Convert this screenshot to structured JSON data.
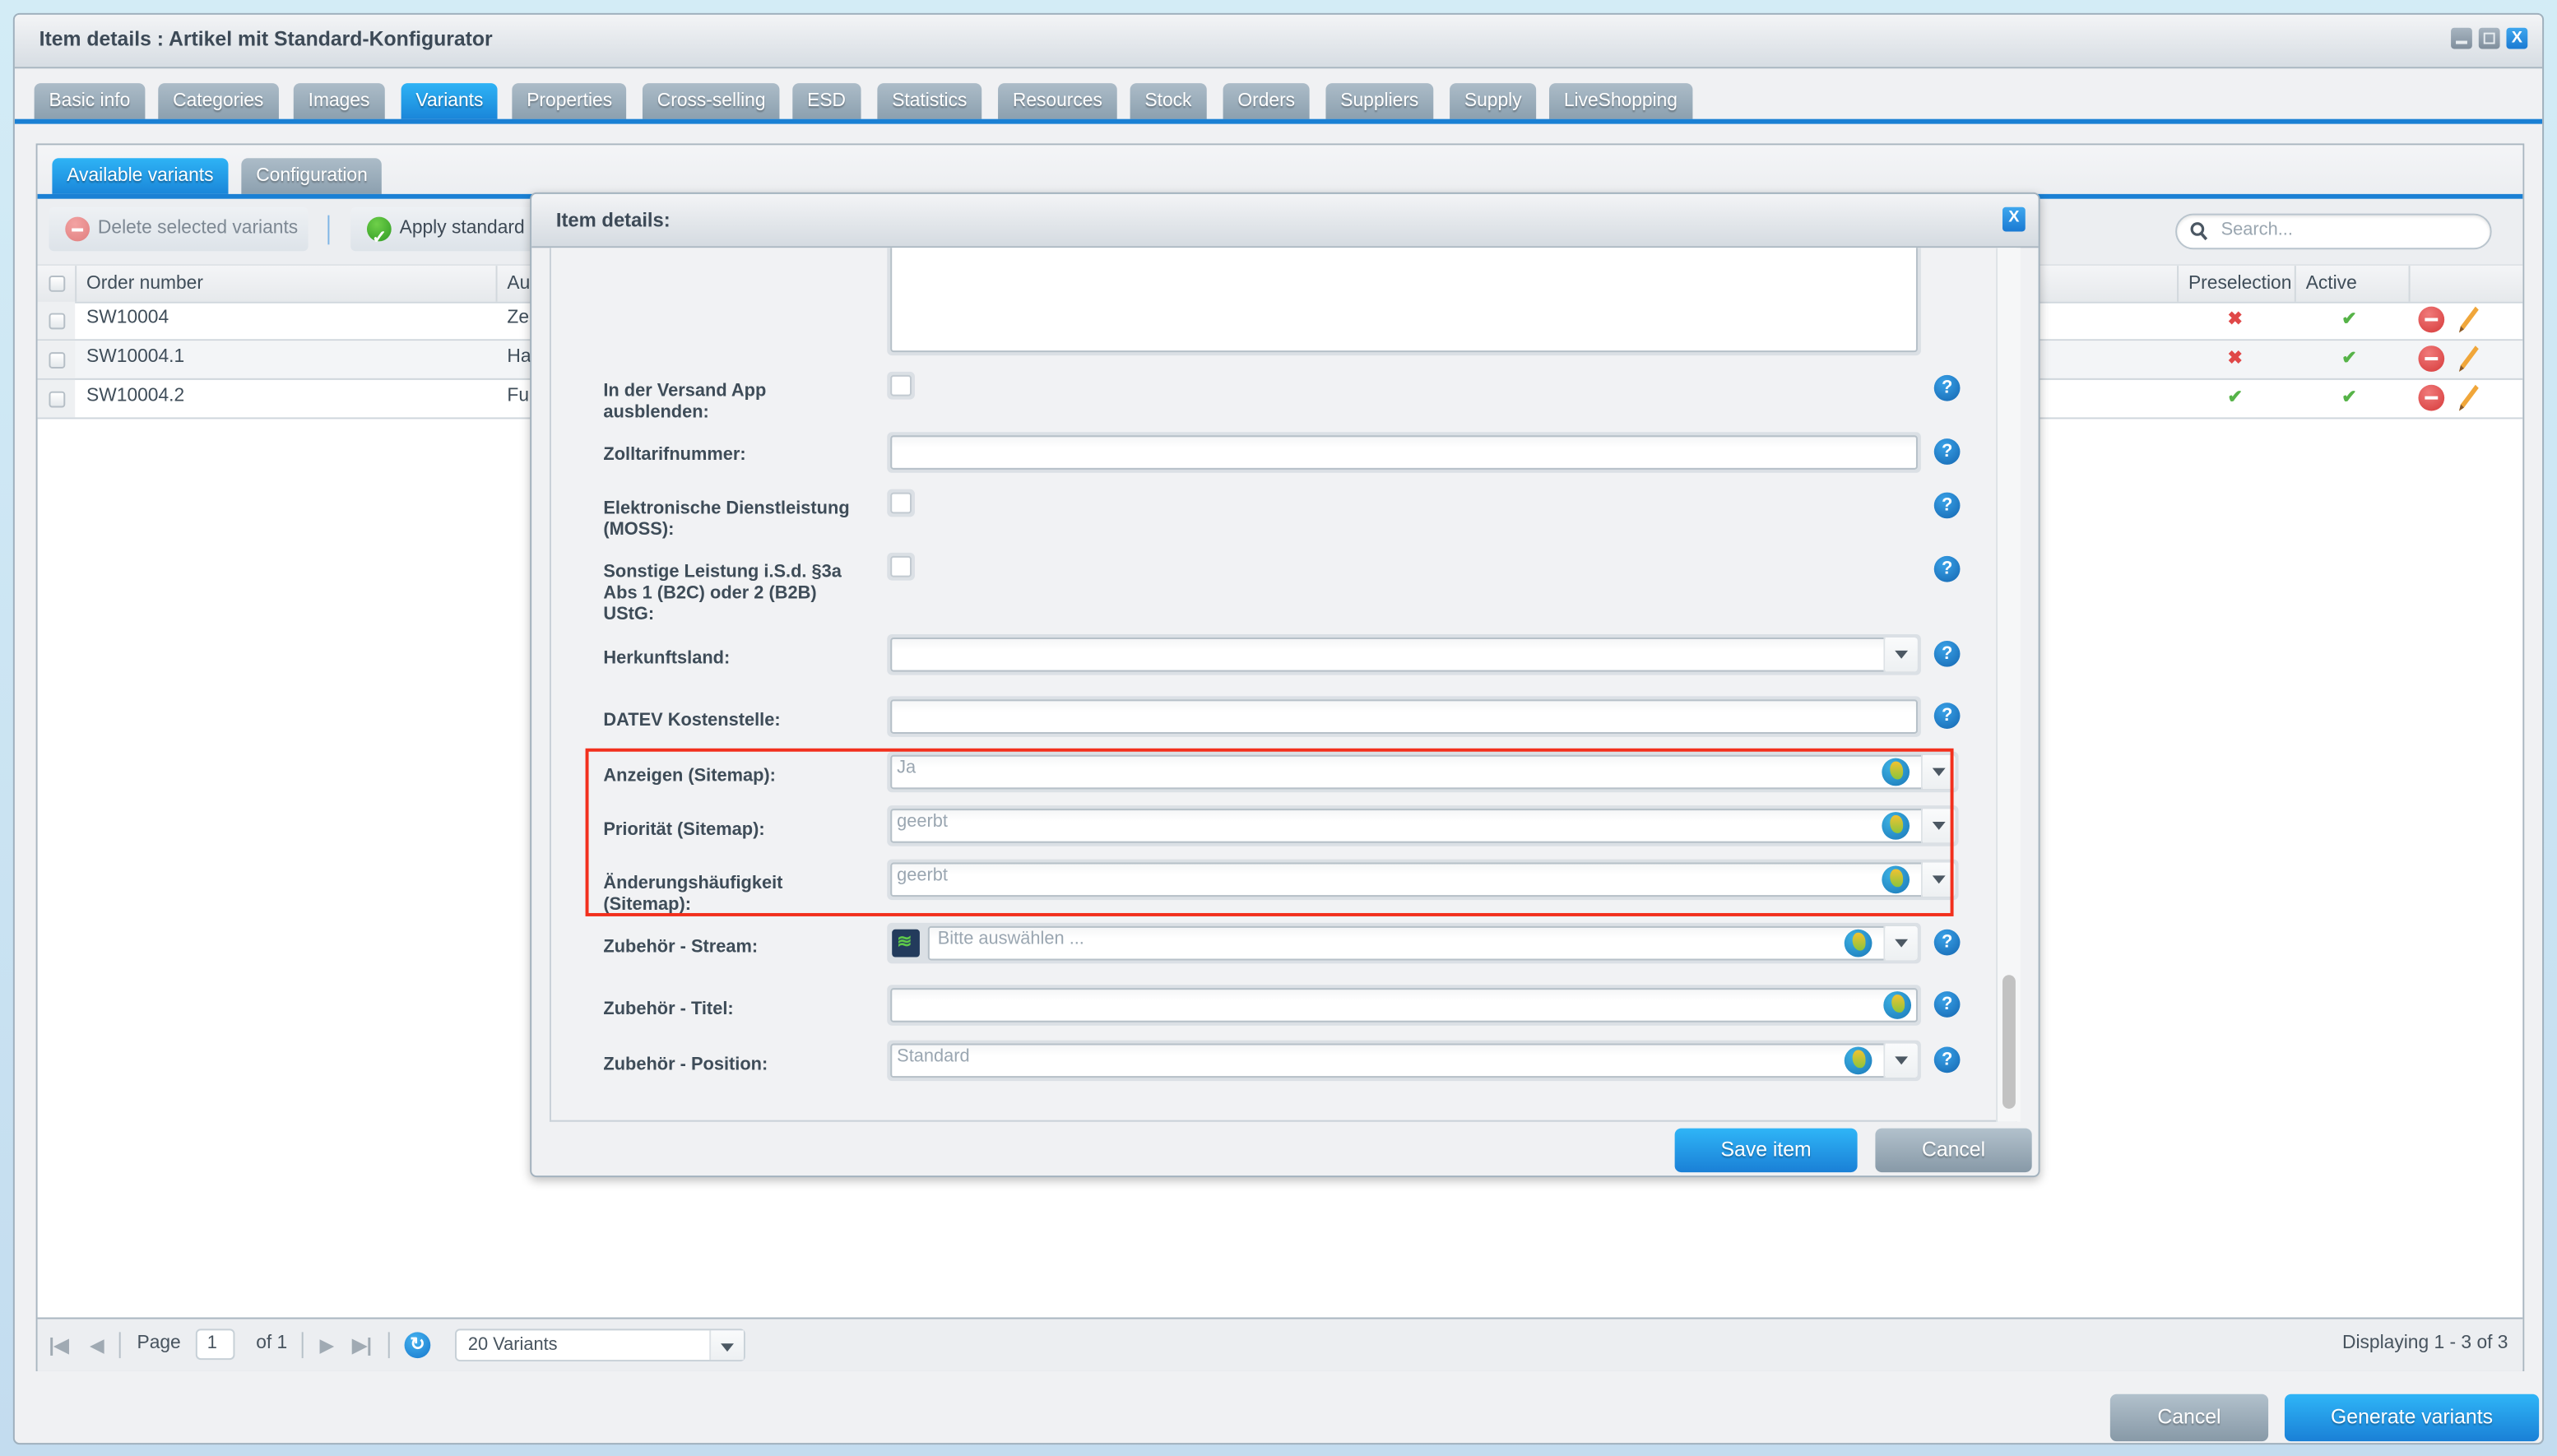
{
  "window": {
    "title": "Item details : Artikel mit Standard-Konfigurator",
    "controls": {
      "minimize": "minimize",
      "maximize": "maximize",
      "close": "X"
    }
  },
  "tabs": [
    {
      "label": "Basic info",
      "active": false
    },
    {
      "label": "Categories",
      "active": false
    },
    {
      "label": "Images",
      "active": false
    },
    {
      "label": "Variants",
      "active": true
    },
    {
      "label": "Properties",
      "active": false
    },
    {
      "label": "Cross-selling",
      "active": false
    },
    {
      "label": "ESD",
      "active": false
    },
    {
      "label": "Statistics",
      "active": false
    },
    {
      "label": "Resources",
      "active": false
    },
    {
      "label": "Stock",
      "active": false
    },
    {
      "label": "Orders",
      "active": false
    },
    {
      "label": "Suppliers",
      "active": false
    },
    {
      "label": "Supply",
      "active": false
    },
    {
      "label": "LiveShopping",
      "active": false
    }
  ],
  "subtabs": [
    {
      "label": "Available variants",
      "active": true
    },
    {
      "label": "Configuration",
      "active": false
    }
  ],
  "toolbar": {
    "delete_label": "Delete selected variants",
    "apply_label": "Apply standard d",
    "search_placeholder": "Search..."
  },
  "grid": {
    "columns": {
      "order_number": "Order number",
      "second": "Au",
      "preselection": "Preselection",
      "active": "Active"
    },
    "rows": [
      {
        "order_number": "SW10004",
        "second": "Ze",
        "preselection": "no",
        "active": "yes"
      },
      {
        "order_number": "SW10004.1",
        "second": "Ha",
        "preselection": "no",
        "active": "yes"
      },
      {
        "order_number": "SW10004.2",
        "second": "Fu",
        "preselection": "yes",
        "active": "yes"
      }
    ],
    "marks": {
      "yes": "✔",
      "no": "✖"
    }
  },
  "paging": {
    "page_label": "Page",
    "page_value": "1",
    "of_label": "of 1",
    "page_size": "20 Variants",
    "displaying": "Displaying 1 - 3 of 3"
  },
  "footer": {
    "cancel_label": "Cancel",
    "generate_label": "Generate variants"
  },
  "modal": {
    "title": "Item details:",
    "close": "X",
    "fields": {
      "versand_app": {
        "label": "In der Versand App ausblenden:",
        "checked": false
      },
      "zolltarif": {
        "label": "Zolltarifnummer:",
        "value": ""
      },
      "moss": {
        "label": "Elektronische Dienstleistung (MOSS):",
        "checked": false
      },
      "sonstige": {
        "label": "Sonstige Leistung i.S.d. §3a Abs 1 (B2C) oder 2 (B2B) UStG:",
        "checked": false
      },
      "herkunftsland": {
        "label": "Herkunftsland:",
        "value": ""
      },
      "datev": {
        "label": "DATEV Kostenstelle:",
        "value": ""
      },
      "sitemap_show": {
        "label": "Anzeigen (Sitemap):",
        "value": "Ja"
      },
      "sitemap_priority": {
        "label": "Priorität (Sitemap):",
        "value": "geerbt"
      },
      "sitemap_freq": {
        "label": "Änderungshäufigkeit (Sitemap):",
        "value": "geerbt"
      },
      "zub_stream": {
        "label": "Zubehör - Stream:",
        "placeholder": "Bitte auswählen ..."
      },
      "zub_titel": {
        "label": "Zubehör - Titel:",
        "value": ""
      },
      "zub_position": {
        "label": "Zubehör - Position:",
        "value": "Standard"
      }
    },
    "help_glyph": "?",
    "save_label": "Save item",
    "cancel_label": "Cancel"
  },
  "colors": {
    "accent_blue": "#1a80d4",
    "highlight_red": "#f2301d",
    "check_green": "#56b348",
    "cross_red": "#e04848"
  }
}
